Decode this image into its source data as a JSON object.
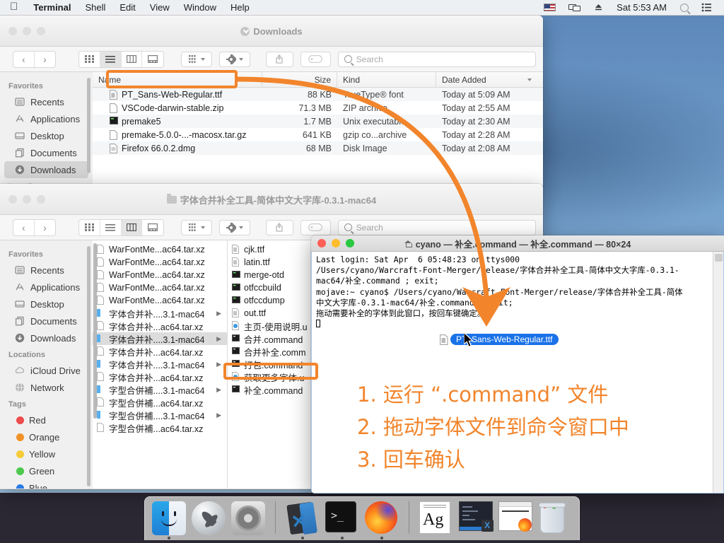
{
  "menubar": {
    "apple_icon": "apple-logo-icon",
    "items": [
      {
        "label": "Terminal",
        "bold": true
      },
      {
        "label": "Shell",
        "bold": false
      },
      {
        "label": "Edit",
        "bold": false
      },
      {
        "label": "View",
        "bold": false
      },
      {
        "label": "Window",
        "bold": false
      },
      {
        "label": "Help",
        "bold": false
      }
    ],
    "status_icons": [
      "us-flag-icon",
      "screen-mirroring-icon",
      "eject-icon"
    ],
    "clock": "Sat 5:53 AM",
    "search_icon": "spotlight-search-icon",
    "control_center_icon": "control-center-icon"
  },
  "finder_downloads": {
    "title": "Downloads",
    "title_icon": "downloads-folder-icon",
    "toolbar": {
      "back_label": "‹",
      "forward_label": "›",
      "view_icon_grid": "icon-view-icon",
      "view_list": "list-view-icon",
      "view_column": "column-view-icon",
      "view_gallery": "gallery-view-icon",
      "group_icon": "group-by-icon",
      "action_icon": "action-gear-icon",
      "share_icon": "share-icon",
      "tag_icon": "tag-icon",
      "search_placeholder": "Search"
    },
    "sidebar": [
      {
        "type": "header",
        "label": "Favorites"
      },
      {
        "type": "item",
        "label": "Recents",
        "icon": "recents-icon",
        "selected": false
      },
      {
        "type": "item",
        "label": "Applications",
        "icon": "applications-icon",
        "selected": false
      },
      {
        "type": "item",
        "label": "Desktop",
        "icon": "desktop-icon",
        "selected": false
      },
      {
        "type": "item",
        "label": "Documents",
        "icon": "documents-icon",
        "selected": false
      },
      {
        "type": "item",
        "label": "Downloads",
        "icon": "downloads-icon",
        "selected": true
      },
      {
        "type": "header",
        "label": "Locations"
      }
    ],
    "columns": [
      "Name",
      "Size",
      "Kind",
      "Date Added"
    ],
    "sort_indicator": "chevron-down-icon",
    "files": [
      {
        "name": "PT_Sans-Web-Regular.ttf",
        "size": "88 KB",
        "kind": "TrueType® font",
        "date": "Today at 5:09 AM",
        "icon": "font-file-icon",
        "highlighted": true
      },
      {
        "name": "VSCode-darwin-stable.zip",
        "size": "71.3 MB",
        "kind": "ZIP archive",
        "date": "Today at 2:55 AM",
        "icon": "archive-file-icon",
        "highlighted": false
      },
      {
        "name": "premake5",
        "size": "1.7 MB",
        "kind": "Unix executable",
        "date": "Today at 2:30 AM",
        "icon": "executable-file-icon",
        "highlighted": false
      },
      {
        "name": "premake-5.0.0-...-macosx.tar.gz",
        "size": "641 KB",
        "kind": "gzip co...archive",
        "date": "Today at 2:28 AM",
        "icon": "archive-file-icon",
        "highlighted": false
      },
      {
        "name": "Firefox 66.0.2.dmg",
        "size": "68 MB",
        "kind": "Disk Image",
        "date": "Today at 2:08 AM",
        "icon": "disk-image-icon",
        "highlighted": false
      }
    ]
  },
  "finder_tool": {
    "title": "字体合并补全工具-简体中文大字库-0.3.1-mac64",
    "title_icon": "folder-icon",
    "toolbar": {
      "back_label": "‹",
      "forward_label": "›",
      "search_placeholder": "Search"
    },
    "sidebar": [
      {
        "type": "header",
        "label": "Favorites"
      },
      {
        "type": "item",
        "label": "Recents",
        "icon": "recents-icon",
        "selected": false
      },
      {
        "type": "item",
        "label": "Applications",
        "icon": "applications-icon",
        "selected": false
      },
      {
        "type": "item",
        "label": "Desktop",
        "icon": "desktop-icon",
        "selected": false
      },
      {
        "type": "item",
        "label": "Documents",
        "icon": "documents-icon",
        "selected": false
      },
      {
        "type": "item",
        "label": "Downloads",
        "icon": "downloads-icon",
        "selected": false
      },
      {
        "type": "header",
        "label": "Locations"
      },
      {
        "type": "item",
        "label": "iCloud Drive",
        "icon": "icloud-icon",
        "selected": false
      },
      {
        "type": "item",
        "label": "Network",
        "icon": "network-globe-icon",
        "selected": false
      },
      {
        "type": "header",
        "label": "Tags"
      },
      {
        "type": "tag",
        "label": "Red",
        "color": "#ec4b4b"
      },
      {
        "type": "tag",
        "label": "Orange",
        "color": "#f09227"
      },
      {
        "type": "tag",
        "label": "Yellow",
        "color": "#f5cc37"
      },
      {
        "type": "tag",
        "label": "Green",
        "color": "#4cc94c"
      },
      {
        "type": "tag",
        "label": "Blue",
        "color": "#2a7ae4"
      }
    ],
    "column_one": [
      {
        "name": "WarFontMe...ac64.tar.xz",
        "icon": "archive-file-icon",
        "has_arrow": false,
        "selected": false
      },
      {
        "name": "WarFontMe...ac64.tar.xz",
        "icon": "archive-file-icon",
        "has_arrow": false,
        "selected": false
      },
      {
        "name": "WarFontMe...ac64.tar.xz",
        "icon": "archive-file-icon",
        "has_arrow": false,
        "selected": false
      },
      {
        "name": "WarFontMe...ac64.tar.xz",
        "icon": "archive-file-icon",
        "has_arrow": false,
        "selected": false
      },
      {
        "name": "WarFontMe...ac64.tar.xz",
        "icon": "archive-file-icon",
        "has_arrow": false,
        "selected": false
      },
      {
        "name": "字体合并补....3.1-mac64",
        "icon": "folder-blue-icon",
        "has_arrow": true,
        "selected": false
      },
      {
        "name": "字体合并补...ac64.tar.xz",
        "icon": "archive-file-icon",
        "has_arrow": false,
        "selected": false
      },
      {
        "name": "字体合并补....3.1-mac64",
        "icon": "folder-blue-icon",
        "has_arrow": true,
        "selected": true
      },
      {
        "name": "字体合并补...ac64.tar.xz",
        "icon": "archive-file-icon",
        "has_arrow": false,
        "selected": false
      },
      {
        "name": "字体合并补....3.1-mac64",
        "icon": "folder-blue-icon",
        "has_arrow": true,
        "selected": false
      },
      {
        "name": "字体合并补...ac64.tar.xz",
        "icon": "archive-file-icon",
        "has_arrow": false,
        "selected": false
      },
      {
        "name": "字型合併補....3.1-mac64",
        "icon": "folder-blue-icon",
        "has_arrow": true,
        "selected": false
      },
      {
        "name": "字型合併補...ac64.tar.xz",
        "icon": "archive-file-icon",
        "has_arrow": false,
        "selected": false
      },
      {
        "name": "字型合併補....3.1-mac64",
        "icon": "folder-blue-icon",
        "has_arrow": true,
        "selected": false
      },
      {
        "name": "字型合併補...ac64.tar.xz",
        "icon": "archive-file-icon",
        "has_arrow": false,
        "selected": false
      }
    ],
    "column_two": [
      {
        "name": "cjk.ttf",
        "icon": "font-file-icon",
        "highlighted": false
      },
      {
        "name": "latin.ttf",
        "icon": "font-file-icon",
        "highlighted": false
      },
      {
        "name": "merge-otd",
        "icon": "executable-file-icon",
        "highlighted": false
      },
      {
        "name": "otfccbuild",
        "icon": "executable-file-icon",
        "highlighted": false
      },
      {
        "name": "otfccdump",
        "icon": "executable-file-icon",
        "highlighted": false
      },
      {
        "name": "out.ttf",
        "icon": "font-file-icon",
        "highlighted": false
      },
      {
        "name": "主页-使用说明.u",
        "icon": "webloc-file-icon",
        "highlighted": false
      },
      {
        "name": "合并.command",
        "icon": "command-file-icon",
        "highlighted": false
      },
      {
        "name": "合并补全.comm",
        "icon": "command-file-icon",
        "highlighted": false
      },
      {
        "name": "打包.command",
        "icon": "command-file-icon",
        "highlighted": false
      },
      {
        "name": "获取更多字体.u",
        "icon": "webloc-file-icon",
        "highlighted": false
      },
      {
        "name": "补全.command",
        "icon": "command-file-icon",
        "highlighted": true
      }
    ],
    "resizer_glyph": "‖"
  },
  "terminal": {
    "title": "cyano — 补全.command — 补全.command — 80×24",
    "title_icon": "home-folder-icon",
    "traffic": {
      "close": "close-button",
      "minimize": "minimize-button",
      "zoom": "zoom-button"
    },
    "lines": [
      "Last login: Sat Apr  6 05:48:23 on ttys000",
      "/Users/cyano/Warcraft-Font-Merger/release/字体合并补全工具-简体中文大字库-0.3.1-",
      "mac64/补全.command ; exit;",
      "mojave:~ cyano$ /Users/cyano/Warcraft-Font-Merger/release/字体合并补全工具-简体",
      "中文大字库-0.3.1-mac64/补全.command ; exit;",
      "拖动需要补全的字体到此窗口，按回车键确定。"
    ],
    "scrollbar_knob": "scrollbar-knob"
  },
  "drag_badge": {
    "filename": "PT_Sans-Web-Regular.ttf",
    "icon": "font-file-icon",
    "highlight_color": "#1a72e8"
  },
  "instructions": {
    "accent_color": "#f2852c",
    "lines": [
      "1. 运行 “.command” 文件",
      "2. 拖动字体文件到命令窗口中",
      "3. 回车确认"
    ]
  },
  "annotations": {
    "accent_color": "#f2852c",
    "highlight_boxes": [
      "PT_Sans-Web-Regular.ttf row",
      "补全.command item"
    ],
    "arrow_label": "drag-arrow"
  },
  "dock": {
    "items": [
      {
        "name": "finder-icon",
        "label": "Finder",
        "running": true
      },
      {
        "name": "launchpad-icon",
        "label": "Launchpad",
        "running": false
      },
      {
        "name": "system-preferences-icon",
        "label": "System Preferences",
        "running": false
      },
      {
        "name": "separator",
        "label": "",
        "running": false
      },
      {
        "name": "vscode-icon",
        "label": "Visual Studio Code",
        "running": true
      },
      {
        "name": "terminal-icon",
        "label": "Terminal",
        "running": true
      },
      {
        "name": "firefox-icon",
        "label": "Firefox",
        "running": true
      },
      {
        "name": "separator",
        "label": "",
        "running": false
      },
      {
        "name": "font-preview-window-icon",
        "label": "Ag",
        "running": false
      },
      {
        "name": "vscode-window-icon",
        "label": "VSCode Window",
        "running": false
      },
      {
        "name": "firefox-window-icon",
        "label": "Firefox Window",
        "running": false
      },
      {
        "name": "trash-icon",
        "label": "Trash",
        "running": false
      }
    ]
  }
}
